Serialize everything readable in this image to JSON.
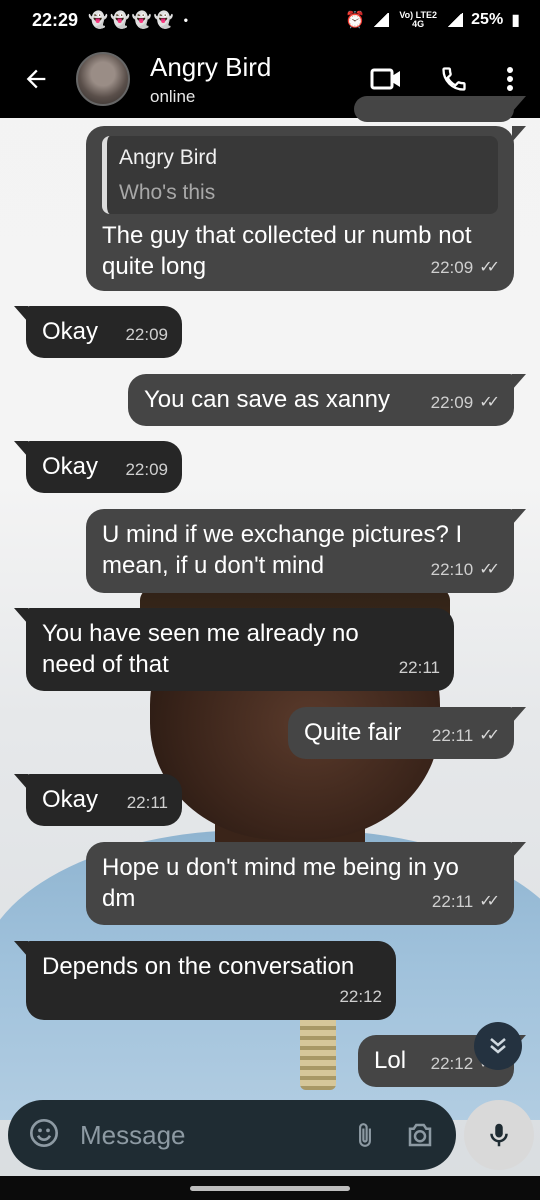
{
  "status_bar": {
    "time": "22:29",
    "notif_icons": "👻👻👻👻",
    "dot": "•",
    "network": "Vo) LTE2 4G",
    "battery": "25%"
  },
  "header": {
    "back_icon": "arrow-left",
    "contact_name": "Angry Bird",
    "status": "online",
    "icons": [
      "video-call",
      "voice-call",
      "more-vertical"
    ]
  },
  "messages": [
    {
      "direction": "out",
      "reply_to": {
        "name": "Angry Bird",
        "text": "Who's this"
      },
      "text": "The guy that collected ur numb not quite long",
      "time": "22:09",
      "ticks": "✓✓"
    },
    {
      "direction": "in",
      "text": "Okay",
      "time": "22:09"
    },
    {
      "direction": "out",
      "text": "You can save as xanny",
      "time": "22:09",
      "ticks": "✓✓"
    },
    {
      "direction": "in",
      "text": "Okay",
      "time": "22:09"
    },
    {
      "direction": "out",
      "text": "U mind if we exchange pictures? I mean, if u don't mind",
      "time": "22:10",
      "ticks": "✓✓"
    },
    {
      "direction": "in",
      "text": "You have seen me already no need of that",
      "time": "22:11"
    },
    {
      "direction": "out",
      "text": "Quite fair",
      "time": "22:11",
      "ticks": "✓✓"
    },
    {
      "direction": "in",
      "text": "Okay",
      "time": "22:11"
    },
    {
      "direction": "out",
      "text": "Hope u don't mind me being in yo dm",
      "time": "22:11",
      "ticks": "✓✓"
    },
    {
      "direction": "in",
      "text": "Depends on the conversation",
      "time": "22:12"
    },
    {
      "direction": "out",
      "text": "Lol",
      "time": "22:12",
      "ticks": "✓✓"
    }
  ],
  "composer": {
    "placeholder": "Message",
    "icons": [
      "emoji",
      "attach",
      "camera"
    ],
    "mic_icon": "microphone"
  },
  "scroll_down_icon": "double-chevron-down"
}
